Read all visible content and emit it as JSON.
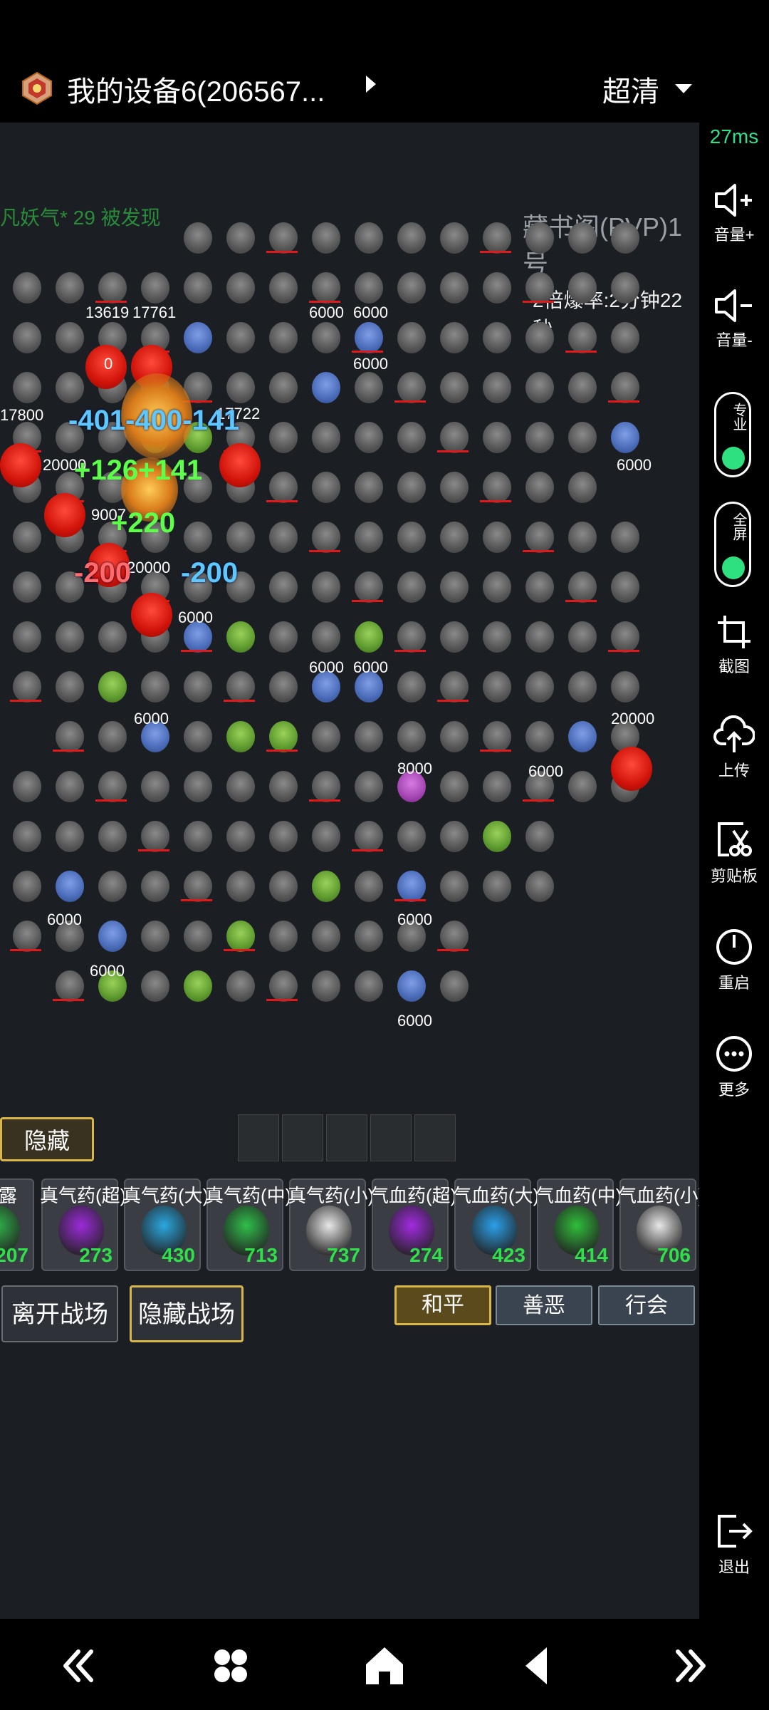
{
  "topbar": {
    "title": "我的设备6(206567...",
    "quality": "超清"
  },
  "rightbar": {
    "latency": "27ms",
    "volume_up": "音量+",
    "volume_down": "音量-",
    "pro_toggle": "专业",
    "fullscreen_toggle": "全屏",
    "screenshot": "截图",
    "upload": "上传",
    "clipboard": "剪贴板",
    "restart": "重启",
    "more": "更多",
    "exit": "退出"
  },
  "game": {
    "system_message": "凡妖气* 29  被发现",
    "map_name": "藏书阁(PVP)1号",
    "drop_rate": "2倍爆率:2分钟22秒",
    "numbers": {
      "n1": "13619",
      "n2": "17761",
      "n3": "0",
      "n4": "17800",
      "n5": "20000",
      "n6": "17722",
      "n7": "9007",
      "n8": "20000",
      "n9": "6000",
      "n10": "6000",
      "n11": "6000",
      "n12": "6000",
      "n13": "6000",
      "n14": "6000",
      "n15": "6000",
      "n16": "6000",
      "n17": "20000",
      "n18": "8000",
      "n19": "6000",
      "n20": "6000",
      "n21": "6000",
      "n22": "6000",
      "n23": "6000",
      "n24": "6000"
    },
    "damage": {
      "d1": "-401-400-141",
      "d2": "+126+141",
      "d3": "+220",
      "d4": "-200",
      "d5": "-200"
    },
    "hide_button": "隐藏",
    "potions": [
      {
        "name": "血露",
        "count": "207"
      },
      {
        "name": "真气药(超)",
        "count": "273"
      },
      {
        "name": "真气药(大)",
        "count": "430"
      },
      {
        "name": "真气药(中)",
        "count": "713"
      },
      {
        "name": "真气药(小)",
        "count": "737"
      },
      {
        "name": "气血药(超)",
        "count": "274"
      },
      {
        "name": "气血药(大)",
        "count": "423"
      },
      {
        "name": "气血药(中)",
        "count": "414"
      },
      {
        "name": "气血药(小)",
        "count": "706"
      }
    ],
    "leave_battle": "离开战场",
    "hide_battle": "隐藏战场",
    "modes": {
      "peace": "和平",
      "good_evil": "善恶",
      "guild": "行会"
    }
  },
  "colors": {
    "accent_gold": "#d8b64a",
    "latency_green": "#2fe08a",
    "toggle_green": "#2ee07f"
  }
}
